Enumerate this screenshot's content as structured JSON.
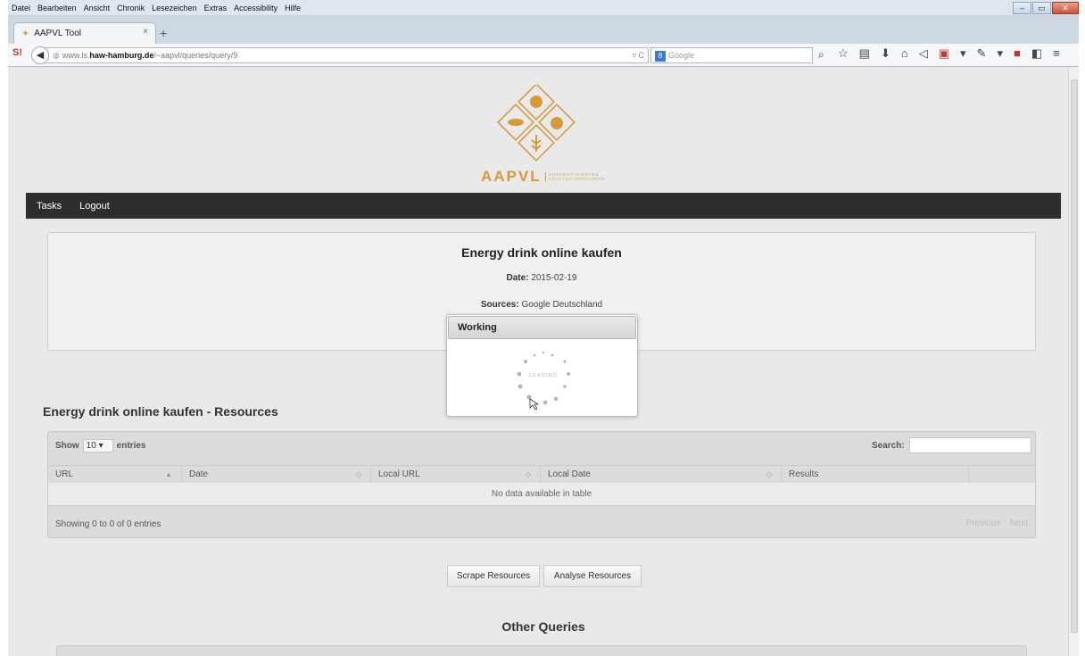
{
  "menubar": {
    "items": [
      "Datei",
      "Bearbeiten",
      "Ansicht",
      "Chronik",
      "Lesezeichen",
      "Extras",
      "Accessibility",
      "Hilfe"
    ]
  },
  "tab": {
    "title": "AAPVL Tool",
    "close": "×",
    "new": "+"
  },
  "nav": {
    "url_prefix": "www.ls.",
    "url_host": "haw-hamburg.de",
    "url_path": "/~aapvl/queries/query/9",
    "url_tools": "▿ C",
    "search_placeholder": "Google",
    "search_engine": "8"
  },
  "logo": {
    "word": "AAPVL",
    "sub": "AUTOMATISIERTES ANALYSEVERFAHREN",
    "color": "#d69a3b"
  },
  "topnav": {
    "tasks": "Tasks",
    "logout": "Logout"
  },
  "query": {
    "title": "Energy drink online kaufen",
    "date_label": "Date:",
    "date_value": "2015-02-19",
    "sources_label": "Sources:",
    "sources_value": "Google Deutschland"
  },
  "working": {
    "title": "Working",
    "loading": "LOADING"
  },
  "resources": {
    "title": "Energy drink online kaufen - Resources",
    "show": "Show",
    "entries_value": "10",
    "entries": "entries",
    "search_label": "Search:",
    "columns": [
      "URL",
      "Date",
      "Local URL",
      "Local Date",
      "Results"
    ],
    "empty": "No data available in table",
    "info": "Showing 0 to 0 of 0 entries",
    "previous": "Previous",
    "next": "Next"
  },
  "buttons": {
    "scrape": "Scrape Resources",
    "analyse": "Analyse Resources"
  },
  "other": {
    "title": "Other Queries"
  }
}
